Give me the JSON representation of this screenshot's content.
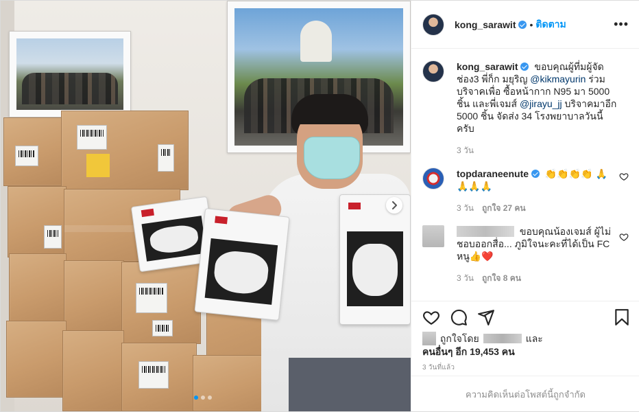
{
  "post": {
    "username": "kong_sarawit",
    "separator": "•",
    "follow_label": "ติดตาม",
    "more_label": "•••",
    "photo_pages": 3,
    "current_page": 1
  },
  "caption": {
    "username": "kong_sarawit",
    "text_1": "ขอบคุณผู้ที่มผู้จัดช่อง3 พี่ก็ก มยุริญ",
    "mention_1": "@kikmayurin",
    "text_2": "ร่วมบริจาคเพื่อ ซื้อหน้ากาก N95 มา 5000 ชิ้น และพี่เจมส์",
    "mention_2": "@jirayu_jj",
    "text_3": "บริจาคมาอีก 5000 ชิ้น จัดส่ง 34 โรงพยาบาลวันนี้ครับ",
    "time": "3 วัน"
  },
  "comments": [
    {
      "username": "topdaraneenute",
      "text": "👏👏👏👏 🙏🙏🙏🙏",
      "time": "3 วัน",
      "likes": "ถูกใจ 27 คน"
    },
    {
      "text": "ขอบคุณน้องเจมส์ ผู้ไม่ชอบออกสื่อ... ภูมิใจนะคะที่ได้เป็น FC หนู👍❤️",
      "time": "3 วัน",
      "likes": "ถูกใจ 8 คน"
    }
  ],
  "actions": {
    "liked_by_prefix": "ถูกใจโดย",
    "liked_by_and": "และ",
    "liked_by_others": "คนอื่นๆ อีก 19,453 คน",
    "posted_time": "3 วันที่แล้ว",
    "comments_limited": "ความคิดเห็นต่อโพสต์นี้ถูกจำกัด"
  },
  "colors": {
    "accent": "#0095f6",
    "verified": "#3897f0",
    "muted": "#8e8e8e",
    "text": "#262626"
  },
  "icons": [
    "more-options-icon",
    "verified-badge-icon",
    "heart-icon",
    "comment-icon",
    "share-icon",
    "bookmark-icon",
    "chevron-right-icon"
  ]
}
